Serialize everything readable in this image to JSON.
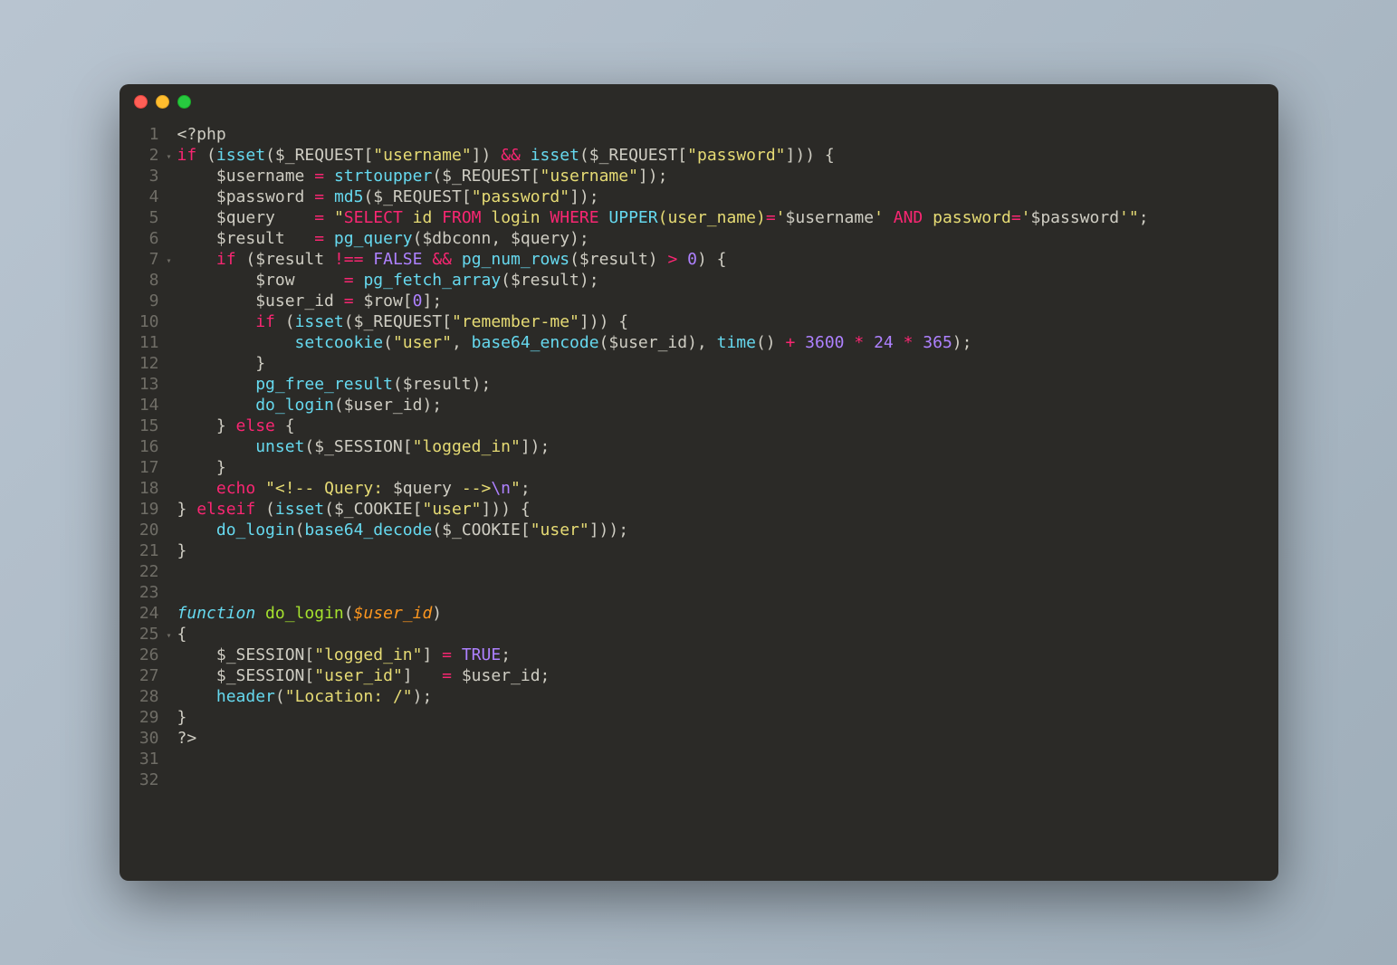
{
  "window": {
    "dot_red": "#ff5f56",
    "dot_yellow": "#ffbd2e",
    "dot_green": "#27c93f"
  },
  "editor": {
    "line_count": 32,
    "fold_markers": {
      "2": "▾",
      "7": "▾",
      "25": "▾"
    },
    "lines": [
      [
        [
          "tag",
          "<?php"
        ]
      ],
      [
        [
          "kw",
          "if"
        ],
        [
          "punc",
          " ("
        ],
        [
          "fn",
          "isset"
        ],
        [
          "punc",
          "("
        ],
        [
          "var",
          "$_REQUEST"
        ],
        [
          "punc",
          "["
        ],
        [
          "str",
          "\"username\""
        ],
        [
          "punc",
          "]) "
        ],
        [
          "op",
          "&&"
        ],
        [
          "punc",
          " "
        ],
        [
          "fn",
          "isset"
        ],
        [
          "punc",
          "("
        ],
        [
          "var",
          "$_REQUEST"
        ],
        [
          "punc",
          "["
        ],
        [
          "str",
          "\"password\""
        ],
        [
          "punc",
          "])) {"
        ]
      ],
      [
        [
          "punc",
          "    "
        ],
        [
          "var",
          "$username"
        ],
        [
          "punc",
          " "
        ],
        [
          "op",
          "="
        ],
        [
          "punc",
          " "
        ],
        [
          "fn",
          "strtoupper"
        ],
        [
          "punc",
          "("
        ],
        [
          "var",
          "$_REQUEST"
        ],
        [
          "punc",
          "["
        ],
        [
          "str",
          "\"username\""
        ],
        [
          "punc",
          "]);"
        ]
      ],
      [
        [
          "punc",
          "    "
        ],
        [
          "var",
          "$password"
        ],
        [
          "punc",
          " "
        ],
        [
          "op",
          "="
        ],
        [
          "punc",
          " "
        ],
        [
          "fn",
          "md5"
        ],
        [
          "punc",
          "("
        ],
        [
          "var",
          "$_REQUEST"
        ],
        [
          "punc",
          "["
        ],
        [
          "str",
          "\"password\""
        ],
        [
          "punc",
          "]);"
        ]
      ],
      [
        [
          "punc",
          "    "
        ],
        [
          "var",
          "$query"
        ],
        [
          "punc",
          "    "
        ],
        [
          "op",
          "="
        ],
        [
          "punc",
          " "
        ],
        [
          "str",
          "\""
        ],
        [
          "kw",
          "SELECT"
        ],
        [
          "str",
          " id "
        ],
        [
          "kw",
          "FROM"
        ],
        [
          "str",
          " login "
        ],
        [
          "kw",
          "WHERE"
        ],
        [
          "str",
          " "
        ],
        [
          "fn",
          "UPPER"
        ],
        [
          "str",
          "(user_name)"
        ],
        [
          "op",
          "="
        ],
        [
          "str",
          "'"
        ],
        [
          "var",
          "$username"
        ],
        [
          "str",
          "' "
        ],
        [
          "kw",
          "AND"
        ],
        [
          "str",
          " password"
        ],
        [
          "op",
          "="
        ],
        [
          "str",
          "'"
        ],
        [
          "var",
          "$password"
        ],
        [
          "str",
          "'\""
        ],
        [
          "punc",
          ";"
        ]
      ],
      [
        [
          "punc",
          "    "
        ],
        [
          "var",
          "$result"
        ],
        [
          "punc",
          "   "
        ],
        [
          "op",
          "="
        ],
        [
          "punc",
          " "
        ],
        [
          "fn",
          "pg_query"
        ],
        [
          "punc",
          "("
        ],
        [
          "var",
          "$dbconn"
        ],
        [
          "punc",
          ", "
        ],
        [
          "var",
          "$query"
        ],
        [
          "punc",
          ");"
        ]
      ],
      [
        [
          "punc",
          "    "
        ],
        [
          "kw",
          "if"
        ],
        [
          "punc",
          " ("
        ],
        [
          "var",
          "$result"
        ],
        [
          "punc",
          " "
        ],
        [
          "op",
          "!=="
        ],
        [
          "punc",
          " "
        ],
        [
          "const",
          "FALSE"
        ],
        [
          "punc",
          " "
        ],
        [
          "op",
          "&&"
        ],
        [
          "punc",
          " "
        ],
        [
          "fn",
          "pg_num_rows"
        ],
        [
          "punc",
          "("
        ],
        [
          "var",
          "$result"
        ],
        [
          "punc",
          ") "
        ],
        [
          "op",
          ">"
        ],
        [
          "punc",
          " "
        ],
        [
          "num",
          "0"
        ],
        [
          "punc",
          ") {"
        ]
      ],
      [
        [
          "punc",
          "        "
        ],
        [
          "var",
          "$row"
        ],
        [
          "punc",
          "     "
        ],
        [
          "op",
          "="
        ],
        [
          "punc",
          " "
        ],
        [
          "fn",
          "pg_fetch_array"
        ],
        [
          "punc",
          "("
        ],
        [
          "var",
          "$result"
        ],
        [
          "punc",
          ");"
        ]
      ],
      [
        [
          "punc",
          "        "
        ],
        [
          "var",
          "$user_id"
        ],
        [
          "punc",
          " "
        ],
        [
          "op",
          "="
        ],
        [
          "punc",
          " "
        ],
        [
          "var",
          "$row"
        ],
        [
          "punc",
          "["
        ],
        [
          "num",
          "0"
        ],
        [
          "punc",
          "];"
        ]
      ],
      [
        [
          "punc",
          "        "
        ],
        [
          "kw",
          "if"
        ],
        [
          "punc",
          " ("
        ],
        [
          "fn",
          "isset"
        ],
        [
          "punc",
          "("
        ],
        [
          "var",
          "$_REQUEST"
        ],
        [
          "punc",
          "["
        ],
        [
          "str",
          "\"remember-me\""
        ],
        [
          "punc",
          "])) {"
        ]
      ],
      [
        [
          "punc",
          "            "
        ],
        [
          "fn",
          "setcookie"
        ],
        [
          "punc",
          "("
        ],
        [
          "str",
          "\"user\""
        ],
        [
          "punc",
          ", "
        ],
        [
          "fn",
          "base64_encode"
        ],
        [
          "punc",
          "("
        ],
        [
          "var",
          "$user_id"
        ],
        [
          "punc",
          "), "
        ],
        [
          "fn",
          "time"
        ],
        [
          "punc",
          "() "
        ],
        [
          "op",
          "+"
        ],
        [
          "punc",
          " "
        ],
        [
          "num",
          "3600"
        ],
        [
          "punc",
          " "
        ],
        [
          "op",
          "*"
        ],
        [
          "punc",
          " "
        ],
        [
          "num",
          "24"
        ],
        [
          "punc",
          " "
        ],
        [
          "op",
          "*"
        ],
        [
          "punc",
          " "
        ],
        [
          "num",
          "365"
        ],
        [
          "punc",
          ");"
        ]
      ],
      [
        [
          "punc",
          "        }"
        ]
      ],
      [
        [
          "punc",
          "        "
        ],
        [
          "fn",
          "pg_free_result"
        ],
        [
          "punc",
          "("
        ],
        [
          "var",
          "$result"
        ],
        [
          "punc",
          ");"
        ]
      ],
      [
        [
          "punc",
          "        "
        ],
        [
          "fn",
          "do_login"
        ],
        [
          "punc",
          "("
        ],
        [
          "var",
          "$user_id"
        ],
        [
          "punc",
          ");"
        ]
      ],
      [
        [
          "punc",
          "    } "
        ],
        [
          "kw",
          "else"
        ],
        [
          "punc",
          " {"
        ]
      ],
      [
        [
          "punc",
          "        "
        ],
        [
          "fn",
          "unset"
        ],
        [
          "punc",
          "("
        ],
        [
          "var",
          "$_SESSION"
        ],
        [
          "punc",
          "["
        ],
        [
          "str",
          "\"logged_in\""
        ],
        [
          "punc",
          "]);"
        ]
      ],
      [
        [
          "punc",
          "    }"
        ]
      ],
      [
        [
          "punc",
          "    "
        ],
        [
          "kw",
          "echo"
        ],
        [
          "punc",
          " "
        ],
        [
          "str",
          "\"<!-- Query: "
        ],
        [
          "var",
          "$query"
        ],
        [
          "str",
          " -->"
        ],
        [
          "esc",
          "\\n"
        ],
        [
          "str",
          "\""
        ],
        [
          "punc",
          ";"
        ]
      ],
      [
        [
          "punc",
          "} "
        ],
        [
          "kw",
          "elseif"
        ],
        [
          "punc",
          " ("
        ],
        [
          "fn",
          "isset"
        ],
        [
          "punc",
          "("
        ],
        [
          "var",
          "$_COOKIE"
        ],
        [
          "punc",
          "["
        ],
        [
          "str",
          "\"user\""
        ],
        [
          "punc",
          "])) {"
        ]
      ],
      [
        [
          "punc",
          "    "
        ],
        [
          "fn",
          "do_login"
        ],
        [
          "punc",
          "("
        ],
        [
          "fn",
          "base64_decode"
        ],
        [
          "punc",
          "("
        ],
        [
          "var",
          "$_COOKIE"
        ],
        [
          "punc",
          "["
        ],
        [
          "str",
          "\"user\""
        ],
        [
          "punc",
          "]));"
        ]
      ],
      [
        [
          "punc",
          "}"
        ]
      ],
      [],
      [],
      [
        [
          "storage",
          "function"
        ],
        [
          "punc",
          " "
        ],
        [
          "fndef",
          "do_login"
        ],
        [
          "punc",
          "("
        ],
        [
          "param",
          "$user_id"
        ],
        [
          "punc",
          ")"
        ]
      ],
      [
        [
          "punc",
          "{"
        ]
      ],
      [
        [
          "punc",
          "    "
        ],
        [
          "var",
          "$_SESSION"
        ],
        [
          "punc",
          "["
        ],
        [
          "str",
          "\"logged_in\""
        ],
        [
          "punc",
          "] "
        ],
        [
          "op",
          "="
        ],
        [
          "punc",
          " "
        ],
        [
          "const",
          "TRUE"
        ],
        [
          "punc",
          ";"
        ]
      ],
      [
        [
          "punc",
          "    "
        ],
        [
          "var",
          "$_SESSION"
        ],
        [
          "punc",
          "["
        ],
        [
          "str",
          "\"user_id\""
        ],
        [
          "punc",
          "]   "
        ],
        [
          "op",
          "="
        ],
        [
          "punc",
          " "
        ],
        [
          "var",
          "$user_id"
        ],
        [
          "punc",
          ";"
        ]
      ],
      [
        [
          "punc",
          "    "
        ],
        [
          "fn",
          "header"
        ],
        [
          "punc",
          "("
        ],
        [
          "str",
          "\"Location: /\""
        ],
        [
          "punc",
          ");"
        ]
      ],
      [
        [
          "punc",
          "}"
        ]
      ],
      [
        [
          "tag",
          "?>"
        ]
      ],
      [],
      []
    ]
  }
}
